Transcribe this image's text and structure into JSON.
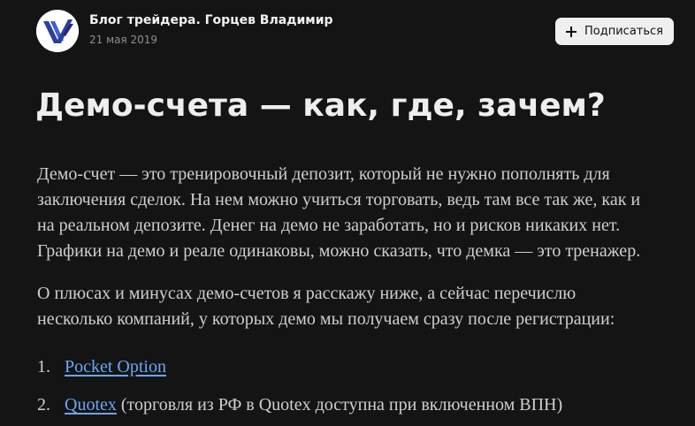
{
  "header": {
    "author": "Блог трейдера. Горцев Владимир",
    "date": "21 мая 2019",
    "subscribe_label": "Подписаться",
    "avatar_icon": "logo-v-icon"
  },
  "article": {
    "title": "Демо-счета — как, где, зачем?",
    "paragraph1_lines": [
      "Демо-счет — это тренировочный депозит, который не нужно пополнять для",
      "заключения сделок. На нем можно учиться торговать, ведь там все так же, как и",
      "на реальном депозите. Денег на демо не заработать, но и рисков никаких нет.",
      "Графики на демо и реале одинаковы, можно сказать, что демка — это тренажер."
    ],
    "paragraph2_lines": [
      "О плюсах и минусах демо-счетов я расскажу ниже, а сейчас перечислю",
      "несколько компаний, у которых демо мы получаем сразу после регистрации:"
    ],
    "list": [
      {
        "num": "1.",
        "link": "Pocket Option",
        "rest": ""
      },
      {
        "num": "2.",
        "link": "Quotex",
        "rest": " (торговля из РФ в Quotex доступна при включенном ВПН)"
      }
    ]
  },
  "colors": {
    "background": "#141414",
    "link": "#6ea6f5",
    "logo_blue": "#2d3fa0"
  }
}
